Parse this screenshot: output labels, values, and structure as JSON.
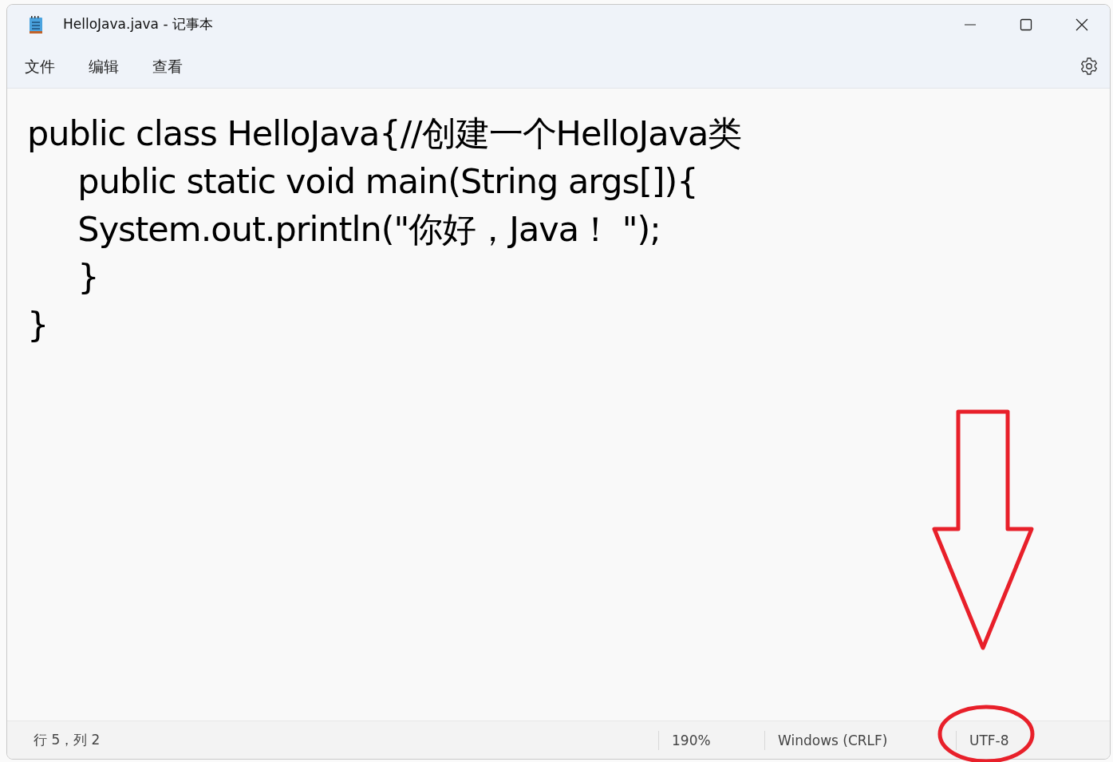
{
  "window": {
    "title": "HelloJava.java - 记事本"
  },
  "menu": [
    {
      "label": "文件"
    },
    {
      "label": "编辑"
    },
    {
      "label": "查看"
    }
  ],
  "editor": {
    "lines": [
      "public class HelloJava{//创建一个HelloJava类",
      "\tpublic static void main(String args[]){",
      "\tSystem.out.println(\"你好，Java！ \");",
      "\t}",
      "}"
    ]
  },
  "status_bar": [
    "行 5，列 2",
    "190%",
    "Windows (CRLF)",
    "UTF-8"
  ]
}
